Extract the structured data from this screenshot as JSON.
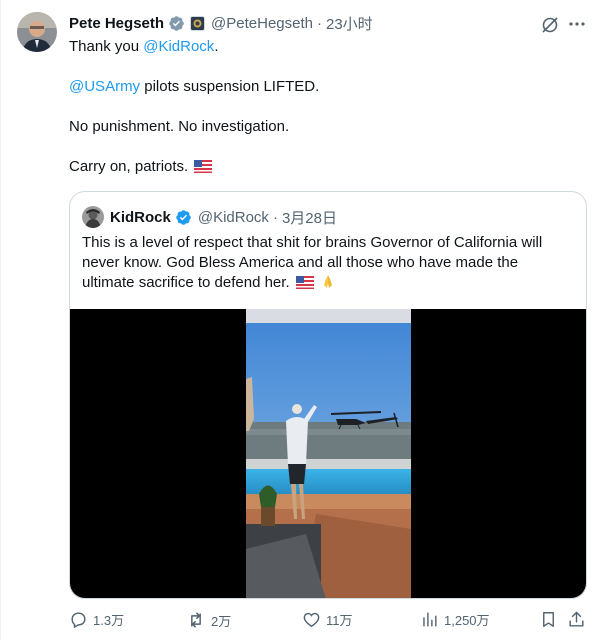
{
  "author": {
    "name": "Pete Hegseth",
    "handle": "@PeteHegseth",
    "time": "23小时",
    "verified_color": "#829aab"
  },
  "tweet": {
    "line1_prefix": "Thank you ",
    "line1_mention": "@KidRock",
    "line1_suffix": ".",
    "line2_mention": "@USArmy",
    "line2_text": " pilots suspension LIFTED.",
    "line3_text": "No punishment. No investigation.",
    "line4_text": "Carry on, patriots. "
  },
  "quote": {
    "name": "KidRock",
    "handle": "@KidRock",
    "date": "3月28日",
    "text": "This is a level of respect that shit for brains Governor of California will never know. God Bless America and all those who have made the ultimate sacrifice to defend her. "
  },
  "actions": {
    "replies": "1.3万",
    "reposts": "2万",
    "likes": "11万",
    "views": "1,250万"
  },
  "icons": {
    "grok": "grok-icon",
    "more": "more-icon",
    "reply": "reply-icon",
    "repost": "repost-icon",
    "like": "heart-icon",
    "views": "views-icon",
    "bookmark": "bookmark-icon",
    "share": "share-icon"
  },
  "colors": {
    "link": "#1d9bf0",
    "text": "#0f1419",
    "muted": "#536471",
    "blue_check": "#1d9bf0"
  }
}
